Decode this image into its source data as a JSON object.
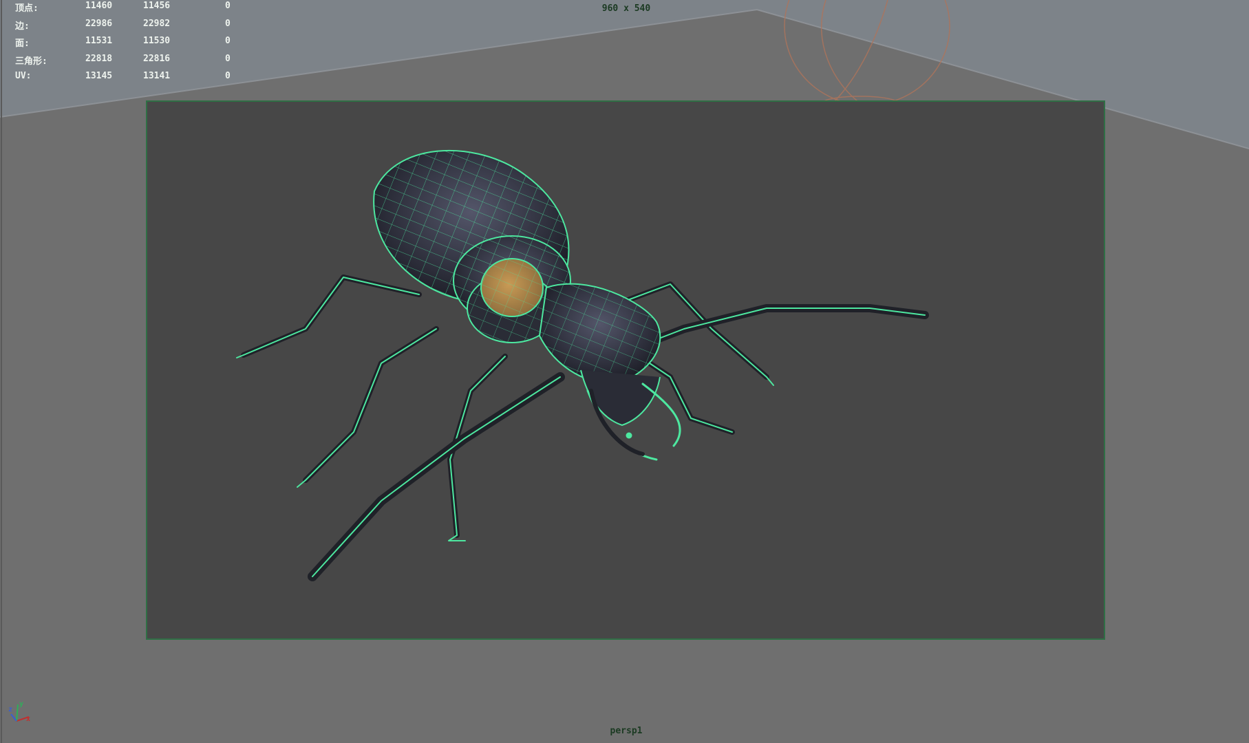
{
  "hud": {
    "rows": [
      {
        "label": "顶点:",
        "v1": "11460",
        "v2": "11456",
        "v3": "0"
      },
      {
        "label": "边:",
        "v1": "22986",
        "v2": "22982",
        "v3": "0"
      },
      {
        "label": "面:",
        "v1": "11531",
        "v2": "11530",
        "v3": "0"
      },
      {
        "label": "三角形:",
        "v1": "22818",
        "v2": "22816",
        "v3": "0"
      },
      {
        "label": "UV:",
        "v1": "13145",
        "v2": "13141",
        "v3": "0"
      }
    ]
  },
  "viewport": {
    "resolution": "960 x 540",
    "camera": "persp1",
    "wire_color": "#4de8a0",
    "gate_color": "#2f6f45",
    "background_color": "#6f6f6f",
    "highlight_color": "#c89a55"
  },
  "axis_gizmo": {
    "x": "x",
    "y": "y",
    "z": "z"
  },
  "icons": [
    "axis-gizmo-icon"
  ]
}
